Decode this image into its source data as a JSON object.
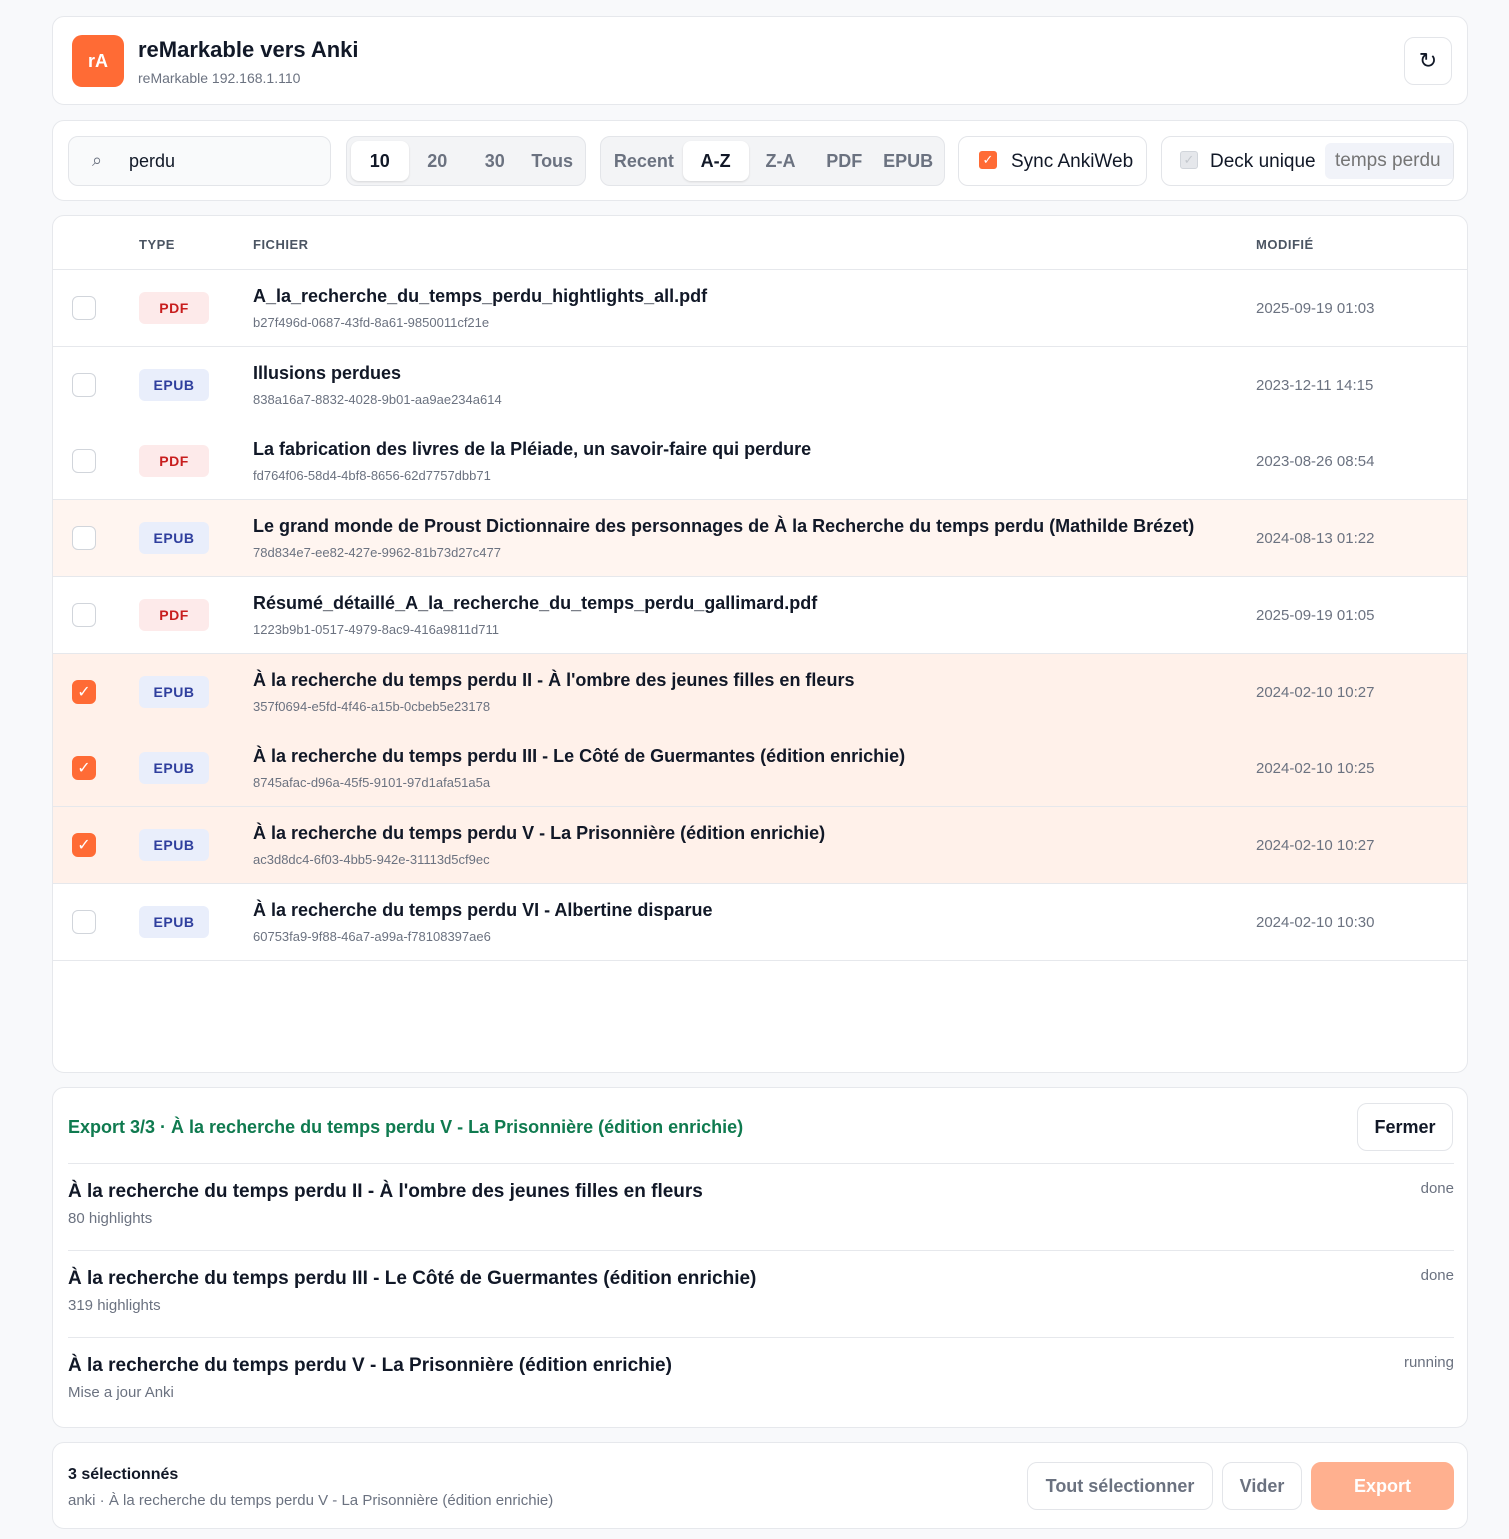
{
  "header": {
    "logo": "rA",
    "title": "reMarkable vers Anki",
    "subtitle": "reMarkable 192.168.1.110",
    "refresh_icon": "↻"
  },
  "toolbar": {
    "search_icon": "⌕",
    "search_value": "perdu",
    "limits": [
      "10",
      "20",
      "30",
      "Tous"
    ],
    "limit_active": "10",
    "sorts": [
      "Recent",
      "A-Z",
      "Z-A",
      "PDF",
      "EPUB"
    ],
    "sort_active": "A-Z",
    "sync_label": "Sync AnkiWeb",
    "sync_checked": true,
    "deck_label": "Deck unique",
    "deck_checked": false,
    "deck_placeholder": "temps perdu"
  },
  "table": {
    "headers": {
      "type": "TYPE",
      "file": "FICHIER",
      "modified": "MODIFIÉ"
    },
    "rows": [
      {
        "type": "PDF",
        "name": "A_la_recherche_du_temps_perdu_hightlights_all.pdf",
        "id": "b27f496d-0687-43fd-8a61-9850011cf21e",
        "date": "2025-09-19 01:03",
        "checked": false
      },
      {
        "type": "EPUB",
        "name": "Illusions perdues",
        "id": "838a16a7-8832-4028-9b01-aa9ae234a614",
        "date": "2023-12-11 14:15",
        "checked": false
      },
      {
        "type": "PDF",
        "name": "La fabrication des livres de la Pléiade, un savoir-faire qui perdure",
        "id": "fd764f06-58d4-4bf8-8656-62d7757dbb71",
        "date": "2023-08-26 08:54",
        "checked": false
      },
      {
        "type": "EPUB",
        "name": "Le grand monde de Proust Dictionnaire des personnages de À la Recherche du temps perdu (Mathilde Brézet)",
        "id": "78d834e7-ee82-427e-9962-81b73d27c477",
        "date": "2024-08-13 01:22",
        "checked": false
      },
      {
        "type": "PDF",
        "name": "Résumé_détaillé_A_la_recherche_du_temps_perdu_gallimard.pdf",
        "id": "1223b9b1-0517-4979-8ac9-416a9811d711",
        "date": "2025-09-19 01:05",
        "checked": false
      },
      {
        "type": "EPUB",
        "name": "À la recherche du temps perdu II - À l'ombre des jeunes filles en fleurs",
        "id": "357f0694-e5fd-4f46-a15b-0cbeb5e23178",
        "date": "2024-02-10 10:27",
        "checked": true
      },
      {
        "type": "EPUB",
        "name": "À la recherche du temps perdu III - Le Côté de Guermantes (édition enrichie)",
        "id": "8745afac-d96a-45f5-9101-97d1afa51a5a",
        "date": "2024-02-10 10:25",
        "checked": true
      },
      {
        "type": "EPUB",
        "name": "À la recherche du temps perdu V - La Prisonnière (édition enrichie)",
        "id": "ac3d8dc4-6f03-4bb5-942e-31113d5cf9ec",
        "date": "2024-02-10 10:27",
        "checked": true
      },
      {
        "type": "EPUB",
        "name": "À la recherche du temps perdu VI - Albertine disparue",
        "id": "60753fa9-9f88-46a7-a99a-f78108397ae6",
        "date": "2024-02-10 10:30",
        "checked": false
      }
    ]
  },
  "export": {
    "title": "Export 3/3 · À la recherche du temps perdu V - La Prisonnière (édition enrichie)",
    "close_label": "Fermer",
    "jobs": [
      {
        "title": "À la recherche du temps perdu II - À l'ombre des jeunes filles en fleurs",
        "detail": "80 highlights",
        "status": "done"
      },
      {
        "title": "À la recherche du temps perdu III - Le Côté de Guermantes (édition enrichie)",
        "detail": "319 highlights",
        "status": "done"
      },
      {
        "title": "À la recherche du temps perdu V - La Prisonnière (édition enrichie)",
        "detail": "Mise a jour Anki",
        "status": "running"
      }
    ]
  },
  "footer": {
    "selected_count": "3 sélectionnés",
    "selected_detail": "anki · À la recherche du temps perdu V - La Prisonnière (édition enrichie)",
    "select_all_label": "Tout sélectionner",
    "clear_label": "Vider",
    "export_label": "Export"
  },
  "colors": {
    "accent": "#ff6b35",
    "success_text": "#0f7a4f",
    "selected_row": "#fff1ea"
  }
}
